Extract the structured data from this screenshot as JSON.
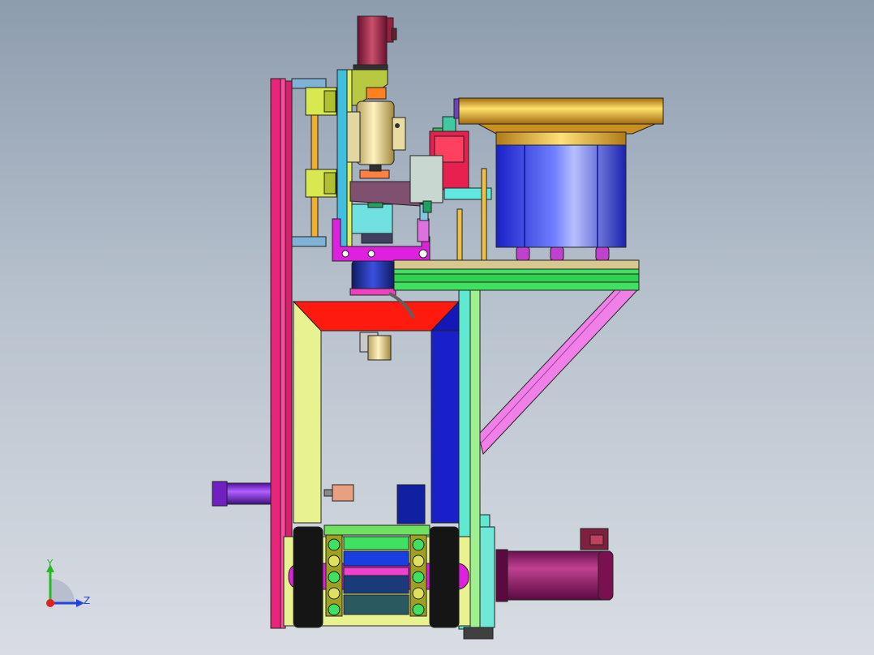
{
  "view": {
    "background_top": "#8d9cae",
    "background_bottom": "#d9dde3"
  },
  "triad": {
    "y_label": "Y",
    "z_label": "Z",
    "y_color": "#22bb22",
    "z_color": "#2244dd",
    "x_color": "#dd2222"
  },
  "palette": {
    "magenta": "#e8257a",
    "olive": "#c8a000",
    "gold": "#c8901a",
    "blue": "#2f3fe6",
    "green": "#2ee04a",
    "red": "#ff1a10",
    "pink": "#f080e8",
    "purple": "#8a1f6a",
    "cyan": "#60e8e0",
    "yellow_green": "#e8f290",
    "navy": "#1418b8",
    "tan": "#d8c890"
  }
}
